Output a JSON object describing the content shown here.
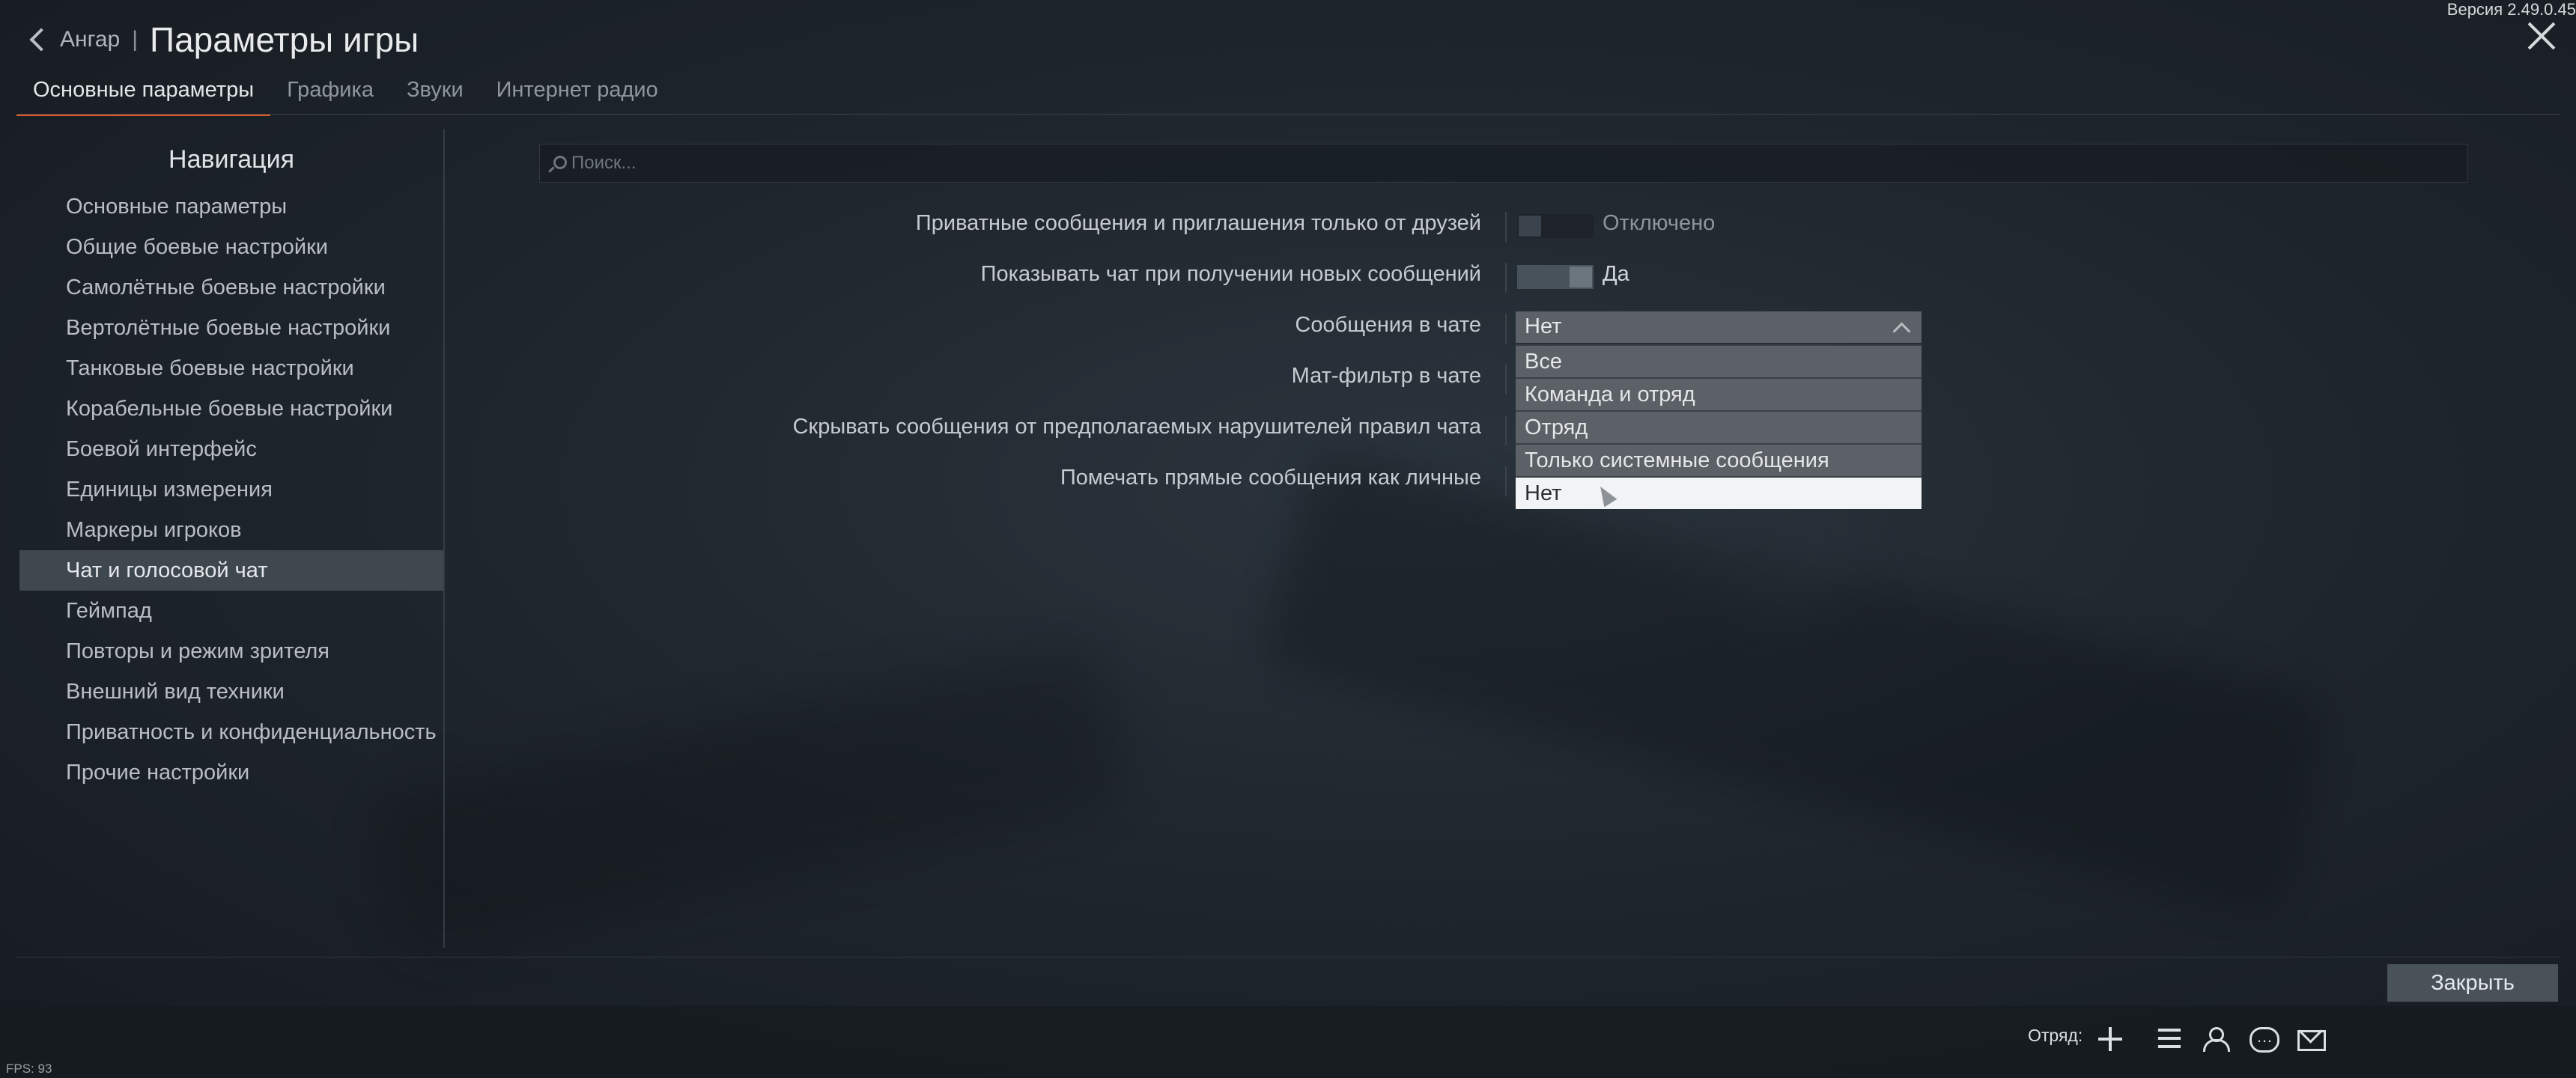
{
  "header": {
    "back_label": "Ангар",
    "separator": "|",
    "title": "Параметры игры",
    "version": "Версия 2.49.0.45"
  },
  "tabs": [
    {
      "label": "Основные параметры",
      "active": true
    },
    {
      "label": "Графика",
      "active": false
    },
    {
      "label": "Звуки",
      "active": false
    },
    {
      "label": "Интернет радио",
      "active": false
    }
  ],
  "nav": {
    "title": "Навигация",
    "items": [
      "Основные параметры",
      "Общие боевые настройки",
      "Самолётные боевые настройки",
      "Вертолётные боевые настройки",
      "Танковые боевые настройки",
      "Корабельные боевые настройки",
      "Боевой интерфейс",
      "Единицы измерения",
      "Маркеры игроков",
      "Чат и голосовой чат",
      "Геймпад",
      "Повторы и режим зрителя",
      "Внешний вид техники",
      "Приватность и конфиденциальность",
      "Прочие настройки"
    ],
    "active_item": "Чат и голосовой чат"
  },
  "search": {
    "value": "",
    "placeholder": "Поиск..."
  },
  "settings": {
    "private_msgs": {
      "label": "Приватные сообщения и приглашения только от друзей",
      "value": "Отключено",
      "on": false
    },
    "show_chat": {
      "label": "Показывать чат при получении новых сообщений",
      "value": "Да",
      "on": true
    },
    "chat_messages": {
      "label": "Сообщения в чате",
      "selected": "Нет",
      "options": [
        "Все",
        "Команда и отряд",
        "Отряд",
        "Только системные сообщения",
        "Нет"
      ]
    },
    "profanity_filter": {
      "label": "Мат-фильтр в чате"
    },
    "hide_violators": {
      "label": "Скрывать сообщения от предполагаемых нарушителей правил чата"
    },
    "mark_direct": {
      "label": "Помечать прямые сообщения как личные"
    }
  },
  "footer": {
    "close_label": "Закрыть",
    "squad_label": "Отряд:",
    "fps": "FPS: 93"
  },
  "icons": [
    "chevron-left-icon",
    "close-icon",
    "search-icon",
    "chevron-up-icon",
    "cursor-icon",
    "plus-icon",
    "list-icon",
    "friends-icon",
    "chat-icon",
    "mail-icon"
  ],
  "colors": {
    "accent": "#e05a2b",
    "background": "#1f262d",
    "dropdown": "#5b6166",
    "selected_option": "#f2f3f4"
  }
}
